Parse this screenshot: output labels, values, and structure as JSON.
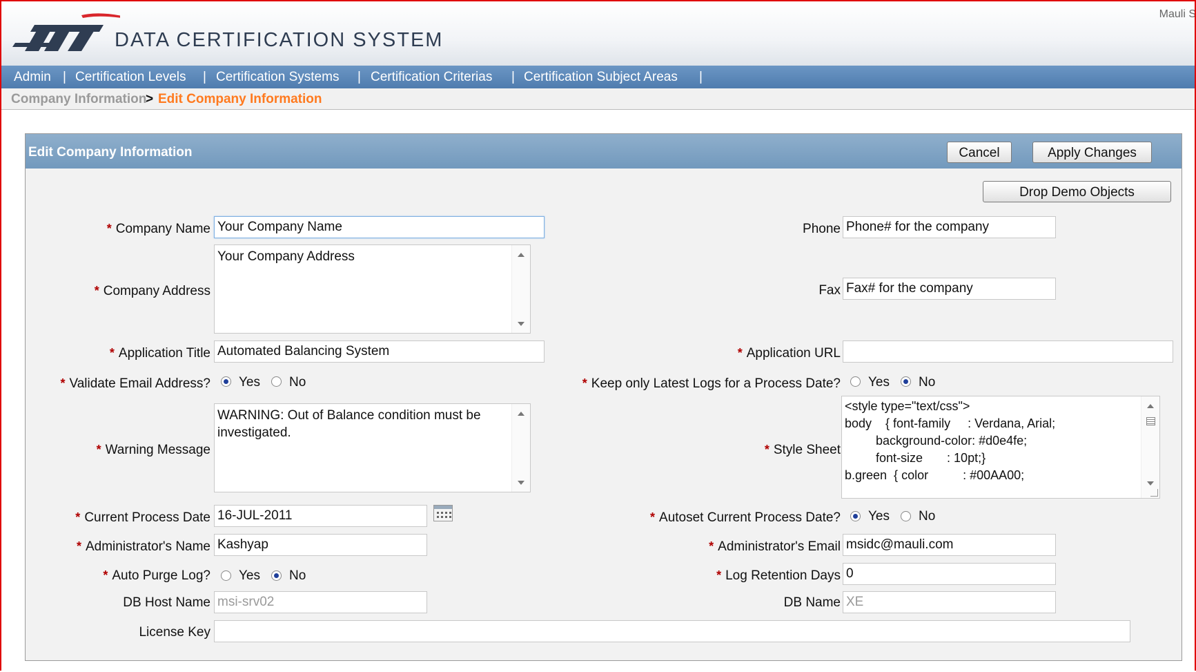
{
  "app": {
    "user": "Mauli S",
    "title": "DATA CERTIFICATION SYSTEM"
  },
  "nav": {
    "items": [
      "Admin",
      "Certification Levels",
      "Certification Systems",
      "Certification Criterias",
      "Certification Subject Areas"
    ],
    "separator": "|"
  },
  "breadcrumb": {
    "parent": "Company Information",
    "separator": ">",
    "current": "Edit Company Information"
  },
  "region": {
    "title": "Edit Company Information",
    "cancel_label": "Cancel",
    "apply_label": "Apply Changes",
    "drop_demo_label": "Drop Demo Objects"
  },
  "form": {
    "required_marker": "*",
    "company_name": {
      "label": "Company Name",
      "value": "Your Company Name"
    },
    "company_address": {
      "label": "Company Address",
      "value": "Your Company Address"
    },
    "application_title": {
      "label": "Application Title",
      "value": "Automated Balancing System"
    },
    "validate_email": {
      "label": "Validate Email Address?",
      "options": [
        "Yes",
        "No"
      ],
      "selected": "Yes"
    },
    "warning_message": {
      "label": "Warning Message",
      "value": "WARNING: Out of Balance condition must be investigated."
    },
    "current_process_date": {
      "label": "Current Process Date",
      "value": "16-JUL-2011"
    },
    "administrator_name": {
      "label": "Administrator's Name",
      "value": "Kashyap"
    },
    "auto_purge_log": {
      "label": "Auto Purge Log?",
      "options": [
        "Yes",
        "No"
      ],
      "selected": "No"
    },
    "db_host_name": {
      "label": "DB Host Name",
      "value": "msi-srv02"
    },
    "license_key": {
      "label": "License Key",
      "value": ""
    },
    "phone": {
      "label": "Phone",
      "value": "Phone# for the company"
    },
    "fax": {
      "label": "Fax",
      "value": "Fax# for the company"
    },
    "application_url": {
      "label": "Application URL",
      "value": ""
    },
    "keep_latest_logs": {
      "label": "Keep only Latest Logs for a Process Date?",
      "options": [
        "Yes",
        "No"
      ],
      "selected": "No"
    },
    "style_sheet": {
      "label": "Style Sheet",
      "value": "<style type=\"text/css\">\nbody    { font-family     : Verdana, Arial;\n         background-color: #d0e4fe;\n         font-size       : 10pt;}\nb.green  { color          : #00AA00;"
    },
    "autoset_process_date": {
      "label": "Autoset Current Process Date?",
      "options": [
        "Yes",
        "No"
      ],
      "selected": "Yes"
    },
    "administrator_email": {
      "label": "Administrator's Email",
      "value": "msidc@mauli.com"
    },
    "log_retention_days": {
      "label": "Log Retention Days",
      "value": "0"
    },
    "db_name": {
      "label": "DB Name",
      "value": "XE"
    }
  }
}
